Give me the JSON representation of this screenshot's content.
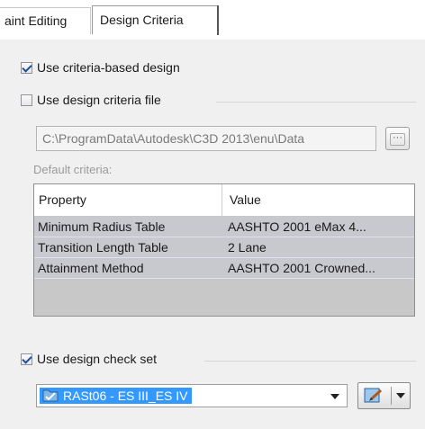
{
  "tabs": [
    {
      "label": "aint Editing",
      "active": false
    },
    {
      "label": "Design Criteria",
      "active": true
    }
  ],
  "use_criteria_based_design": {
    "label": "Use criteria-based design",
    "checked": true
  },
  "use_design_criteria_file": {
    "label": "Use design criteria file",
    "checked": false
  },
  "criteria_file_path": "C:\\ProgramData\\Autodesk\\C3D 2013\\enu\\Data",
  "browse_label": "···",
  "default_criteria_label": "Default criteria:",
  "criteria_table": {
    "headers": [
      "Property",
      "Value"
    ],
    "rows": [
      [
        "Minimum Radius Table",
        "AASHTO 2001 eMax 4..."
      ],
      [
        "Transition Length Table",
        "2 Lane"
      ],
      [
        "Attainment Method",
        "AASHTO 2001 Crowned..."
      ]
    ]
  },
  "use_design_check_set": {
    "label": "Use design check set",
    "checked": true
  },
  "design_check_set": {
    "selected": "RASt06 - ES III_ES IV",
    "icon": "check-set-icon"
  },
  "colors": {
    "selection": "#3399ff",
    "grid_bg": "#c8c8cf",
    "panel_bg": "#f0f0f0"
  }
}
